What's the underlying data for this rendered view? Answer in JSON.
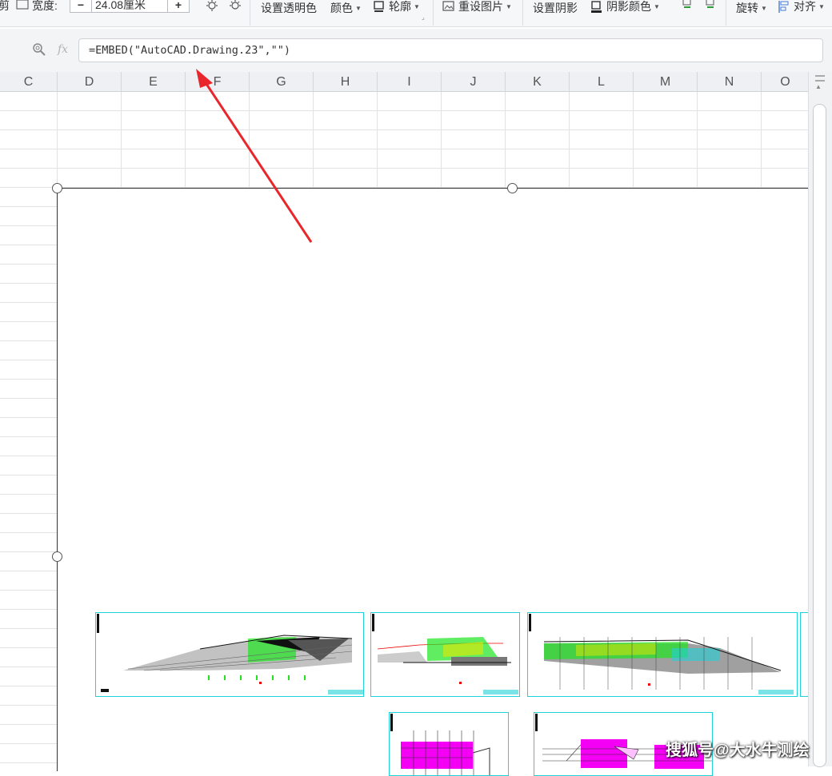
{
  "ribbon": {
    "crop_label": "剪",
    "width_label": "宽度:",
    "width_value": "24.08厘米",
    "minus": "−",
    "plus": "+",
    "set_transparent": "设置透明色",
    "color": "颜色",
    "outline": "轮廓",
    "reset_picture": "重设图片",
    "set_shadow": "设置阴影",
    "shadow_color": "阴影颜色",
    "rotate": "旋转",
    "align": "对齐"
  },
  "formula": {
    "fx": "fx",
    "content": "=EMBED(\"AutoCAD.Drawing.23\",\"\")"
  },
  "columns": [
    "C",
    "D",
    "E",
    "F",
    "G",
    "H",
    "I",
    "J",
    "K",
    "L",
    "M",
    "N",
    "O"
  ],
  "annotation": {
    "arrow_color": "#e8262b"
  },
  "watermark": "搜狐号@大水牛测绘",
  "colors": {
    "drawing_border": "#1fd1d8",
    "magenta": "#f400f4",
    "green": "#1ee51e"
  }
}
